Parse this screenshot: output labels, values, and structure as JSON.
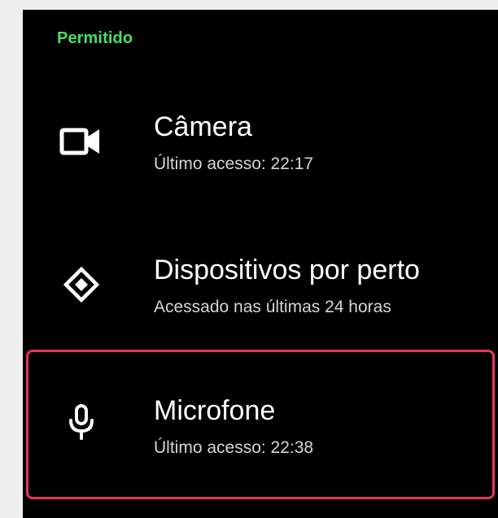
{
  "section": {
    "header": "Permitido"
  },
  "permissions": [
    {
      "title": "Câmera",
      "subtitle": "Último acesso: 22:17",
      "icon": "camera-icon"
    },
    {
      "title": "Dispositivos por perto",
      "subtitle": "Acessado nas últimas 24 horas",
      "icon": "nearby-devices-icon"
    },
    {
      "title": "Microfone",
      "subtitle": "Último acesso: 22:38",
      "icon": "microphone-icon",
      "highlighted": true
    }
  ],
  "colors": {
    "background": "#000000",
    "header_accent": "#4ade63",
    "highlight_border": "#e8355e",
    "outer_background": "#efefef"
  }
}
